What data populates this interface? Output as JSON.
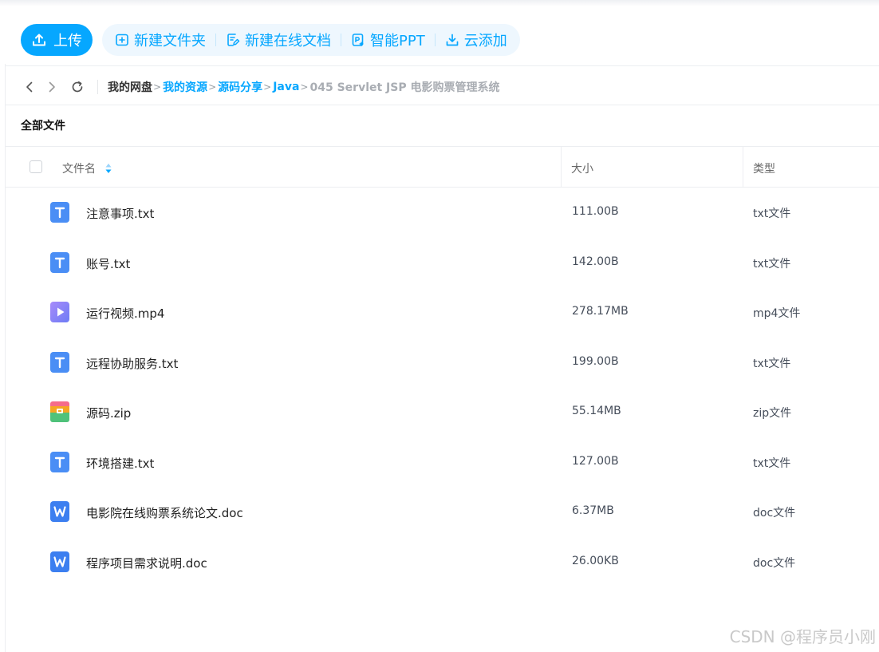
{
  "toolbar": {
    "upload_label": "上传",
    "new_folder_label": "新建文件夹",
    "new_doc_label": "新建在线文档",
    "smart_ppt_label": "智能PPT",
    "cloud_add_label": "云添加"
  },
  "breadcrumb": {
    "items": [
      "我的网盘",
      "我的资源",
      "源码分享",
      "Java",
      "045 Servlet JSP 电影购票管理系统"
    ]
  },
  "section_title": "全部文件",
  "table": {
    "columns": {
      "name": "文件名",
      "size": "大小",
      "type": "类型"
    },
    "rows": [
      {
        "icon": "txt-file-icon",
        "name": "注意事项.txt",
        "size": "111.00B",
        "type": "txt文件"
      },
      {
        "icon": "txt-file-icon",
        "name": "账号.txt",
        "size": "142.00B",
        "type": "txt文件"
      },
      {
        "icon": "video-file-icon",
        "name": "运行视频.mp4",
        "size": "278.17MB",
        "type": "mp4文件"
      },
      {
        "icon": "txt-file-icon",
        "name": "远程协助服务.txt",
        "size": "199.00B",
        "type": "txt文件"
      },
      {
        "icon": "zip-file-icon",
        "name": "源码.zip",
        "size": "55.14MB",
        "type": "zip文件"
      },
      {
        "icon": "txt-file-icon",
        "name": "环境搭建.txt",
        "size": "127.00B",
        "type": "txt文件"
      },
      {
        "icon": "doc-file-icon",
        "name": "电影院在线购票系统论文.doc",
        "size": "6.37MB",
        "type": "doc文件"
      },
      {
        "icon": "doc-file-icon",
        "name": "程序项目需求说明.doc",
        "size": "26.00KB",
        "type": "doc文件"
      }
    ]
  },
  "watermark": "CSDN @程序员小刚",
  "colors": {
    "accent": "#06a7ff",
    "toolbar_bg": "#eef7fe",
    "txt_icon": "#4a8ef5",
    "video_icon": "#8a7ff5",
    "doc_icon": "#3c7ff0"
  }
}
